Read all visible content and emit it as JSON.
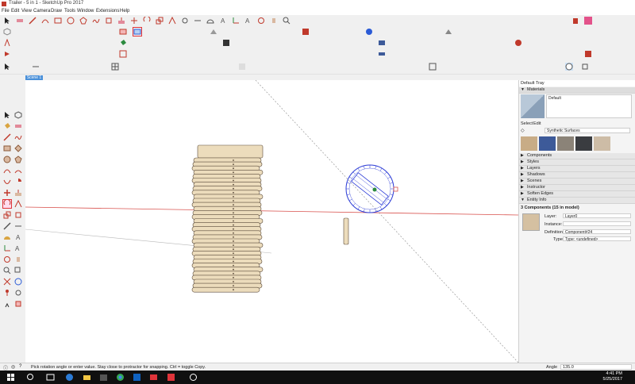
{
  "window": {
    "title": "Trailer - 5 in 1 - SketchUp Pro 2017"
  },
  "menu": [
    "File",
    "Edit",
    "View",
    "Camera",
    "Draw",
    "Tools",
    "Window",
    "Extensions",
    "Help"
  ],
  "scene_tab": "Scene 1",
  "tray": {
    "title": "Default Tray",
    "materials": {
      "header": "Materials",
      "current": "Default",
      "tabs": [
        "Select",
        "Edit"
      ],
      "library": "Synthetic Surfaces",
      "swatches": [
        "#c8ac86",
        "#3d5a99",
        "#8b8378",
        "#3a3c40",
        "#cdbca6"
      ]
    },
    "panels": [
      "Components",
      "Styles",
      "Layers",
      "Shadows",
      "Scenes",
      "Instructor",
      "Soften Edges",
      "Entity Info"
    ],
    "entity_info": {
      "summary": "3 Components (15 in model)",
      "layer_label": "Layer:",
      "layer_value": "Layer0",
      "instance_label": "Instance:",
      "instance_value": "",
      "definition_label": "Definition:",
      "definition_value": "Component#24",
      "type_label": "Type:",
      "type_value": "Type: <undefined>",
      "swatch_color": "#d5c0a1"
    }
  },
  "status": {
    "message": "Pick rotation angle or enter value.  Stay close to protractor for snapping. Ctrl = toggle Copy.",
    "angle_label": "Angle",
    "angle_value": "135.0"
  },
  "taskbar": {
    "time": "4:41 PM",
    "date": "5/25/2017"
  },
  "colors": {
    "accent": "#4a90d9",
    "plank_fill": "#ecdcbc",
    "plank_stroke": "#5a4a3a",
    "protractor": "#2b3bd6",
    "red_axis": "#d9534f"
  }
}
